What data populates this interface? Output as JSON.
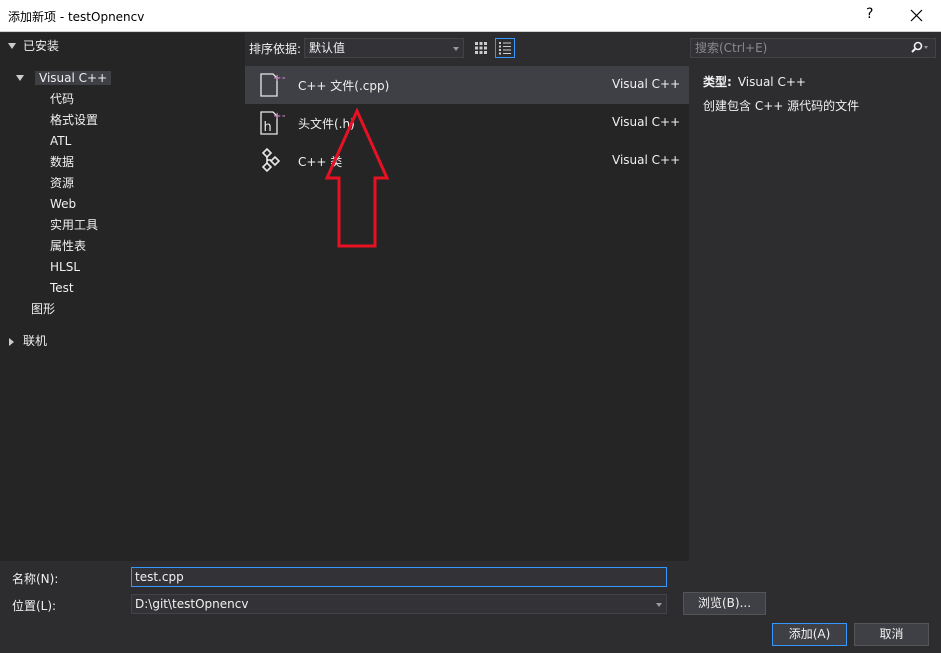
{
  "window": {
    "title": "添加新项 - testOpnencv",
    "help_label": "?"
  },
  "tree": {
    "installed": "已安装",
    "visual_cpp": "Visual C++",
    "children": [
      "代码",
      "格式设置",
      "ATL",
      "数据",
      "资源",
      "Web",
      "实用工具",
      "属性表",
      "HLSL",
      "Test"
    ],
    "graphics": "图形",
    "online": "联机"
  },
  "toolbar": {
    "sort_label": "排序依据:",
    "sort_value": "默认值"
  },
  "search": {
    "placeholder": "搜索(Ctrl+E)"
  },
  "templates": [
    {
      "name": "C++ 文件(.cpp)",
      "kind": "Visual C++",
      "icon": "cpp-file-icon",
      "selected": true
    },
    {
      "name": "头文件(.h)",
      "kind": "Visual C++",
      "icon": "header-file-icon",
      "selected": false
    },
    {
      "name": "C++ 类",
      "kind": "Visual C++",
      "icon": "cpp-class-icon",
      "selected": false
    }
  ],
  "details": {
    "type_label": "类型:",
    "type_value": "Visual C++",
    "description": "创建包含 C++ 源代码的文件"
  },
  "form": {
    "name_label": "名称(N):",
    "name_value": "test.cpp",
    "location_label": "位置(L):",
    "location_value": "D:\\git\\testOpnencv",
    "browse_label": "浏览(B)...",
    "add_label": "添加(A)",
    "cancel_label": "取消"
  },
  "colors": {
    "background": "#2d2d30",
    "panel": "#252526",
    "selection": "#3f3f46",
    "accent": "#3399ff",
    "annotation": "#e81123",
    "icon_plus": "#c586c0"
  }
}
